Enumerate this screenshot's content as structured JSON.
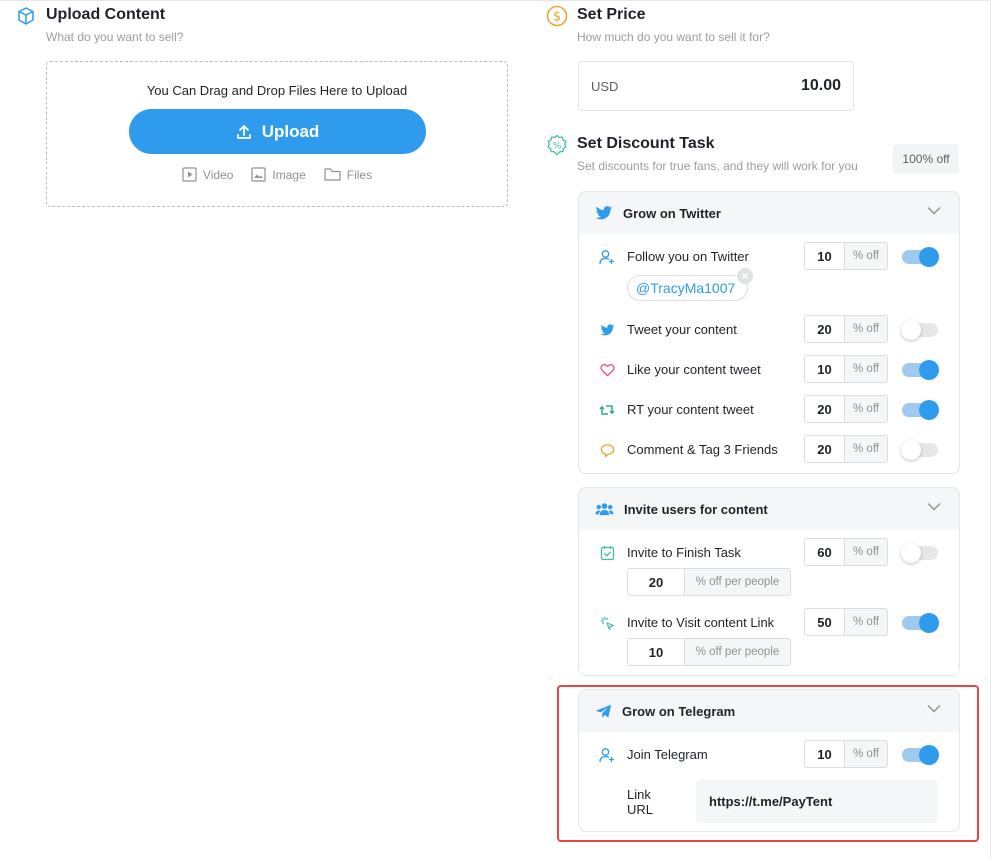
{
  "upload": {
    "title": "Upload Content",
    "subtitle": "What do you want to sell?",
    "drop_text": "You Can Drag and Drop Files Here to Upload",
    "button_label": "Upload",
    "types": [
      "Video",
      "Image",
      "Files"
    ]
  },
  "price": {
    "title": "Set Price",
    "subtitle": "How much do you want to sell it for?",
    "currency": "USD",
    "value": "10.00"
  },
  "discount": {
    "title": "Set Discount Task",
    "subtitle": "Set discounts for true fans, and they will work for you",
    "badge": "100% off"
  },
  "twitter": {
    "title": "Grow on Twitter",
    "handle": "@TracyMa1007",
    "suffix": "% off",
    "tasks": [
      {
        "label": "Follow you on Twitter",
        "value": "10",
        "on": true
      },
      {
        "label": "Tweet your content",
        "value": "20",
        "on": false
      },
      {
        "label": "Like your content tweet",
        "value": "10",
        "on": true
      },
      {
        "label": "RT your content tweet",
        "value": "20",
        "on": true
      },
      {
        "label": "Comment & Tag 3 Friends",
        "value": "20",
        "on": false
      }
    ]
  },
  "invite": {
    "title": "Invite users for content",
    "suffix": "% off",
    "per_suffix": "% off per people",
    "tasks": [
      {
        "label": "Invite to Finish Task",
        "value": "60",
        "per": "20",
        "on": false
      },
      {
        "label": "Invite to Visit content Link",
        "value": "50",
        "per": "10",
        "on": true
      }
    ]
  },
  "telegram": {
    "title": "Grow on Telegram",
    "suffix": "% off",
    "task": {
      "label": "Join Telegram",
      "value": "10",
      "on": true
    },
    "link_label": "Link URL",
    "link_value": "https://t.me/PayTent"
  },
  "colors": {
    "accent": "#2f9bec",
    "highlight": "#e0484a"
  }
}
